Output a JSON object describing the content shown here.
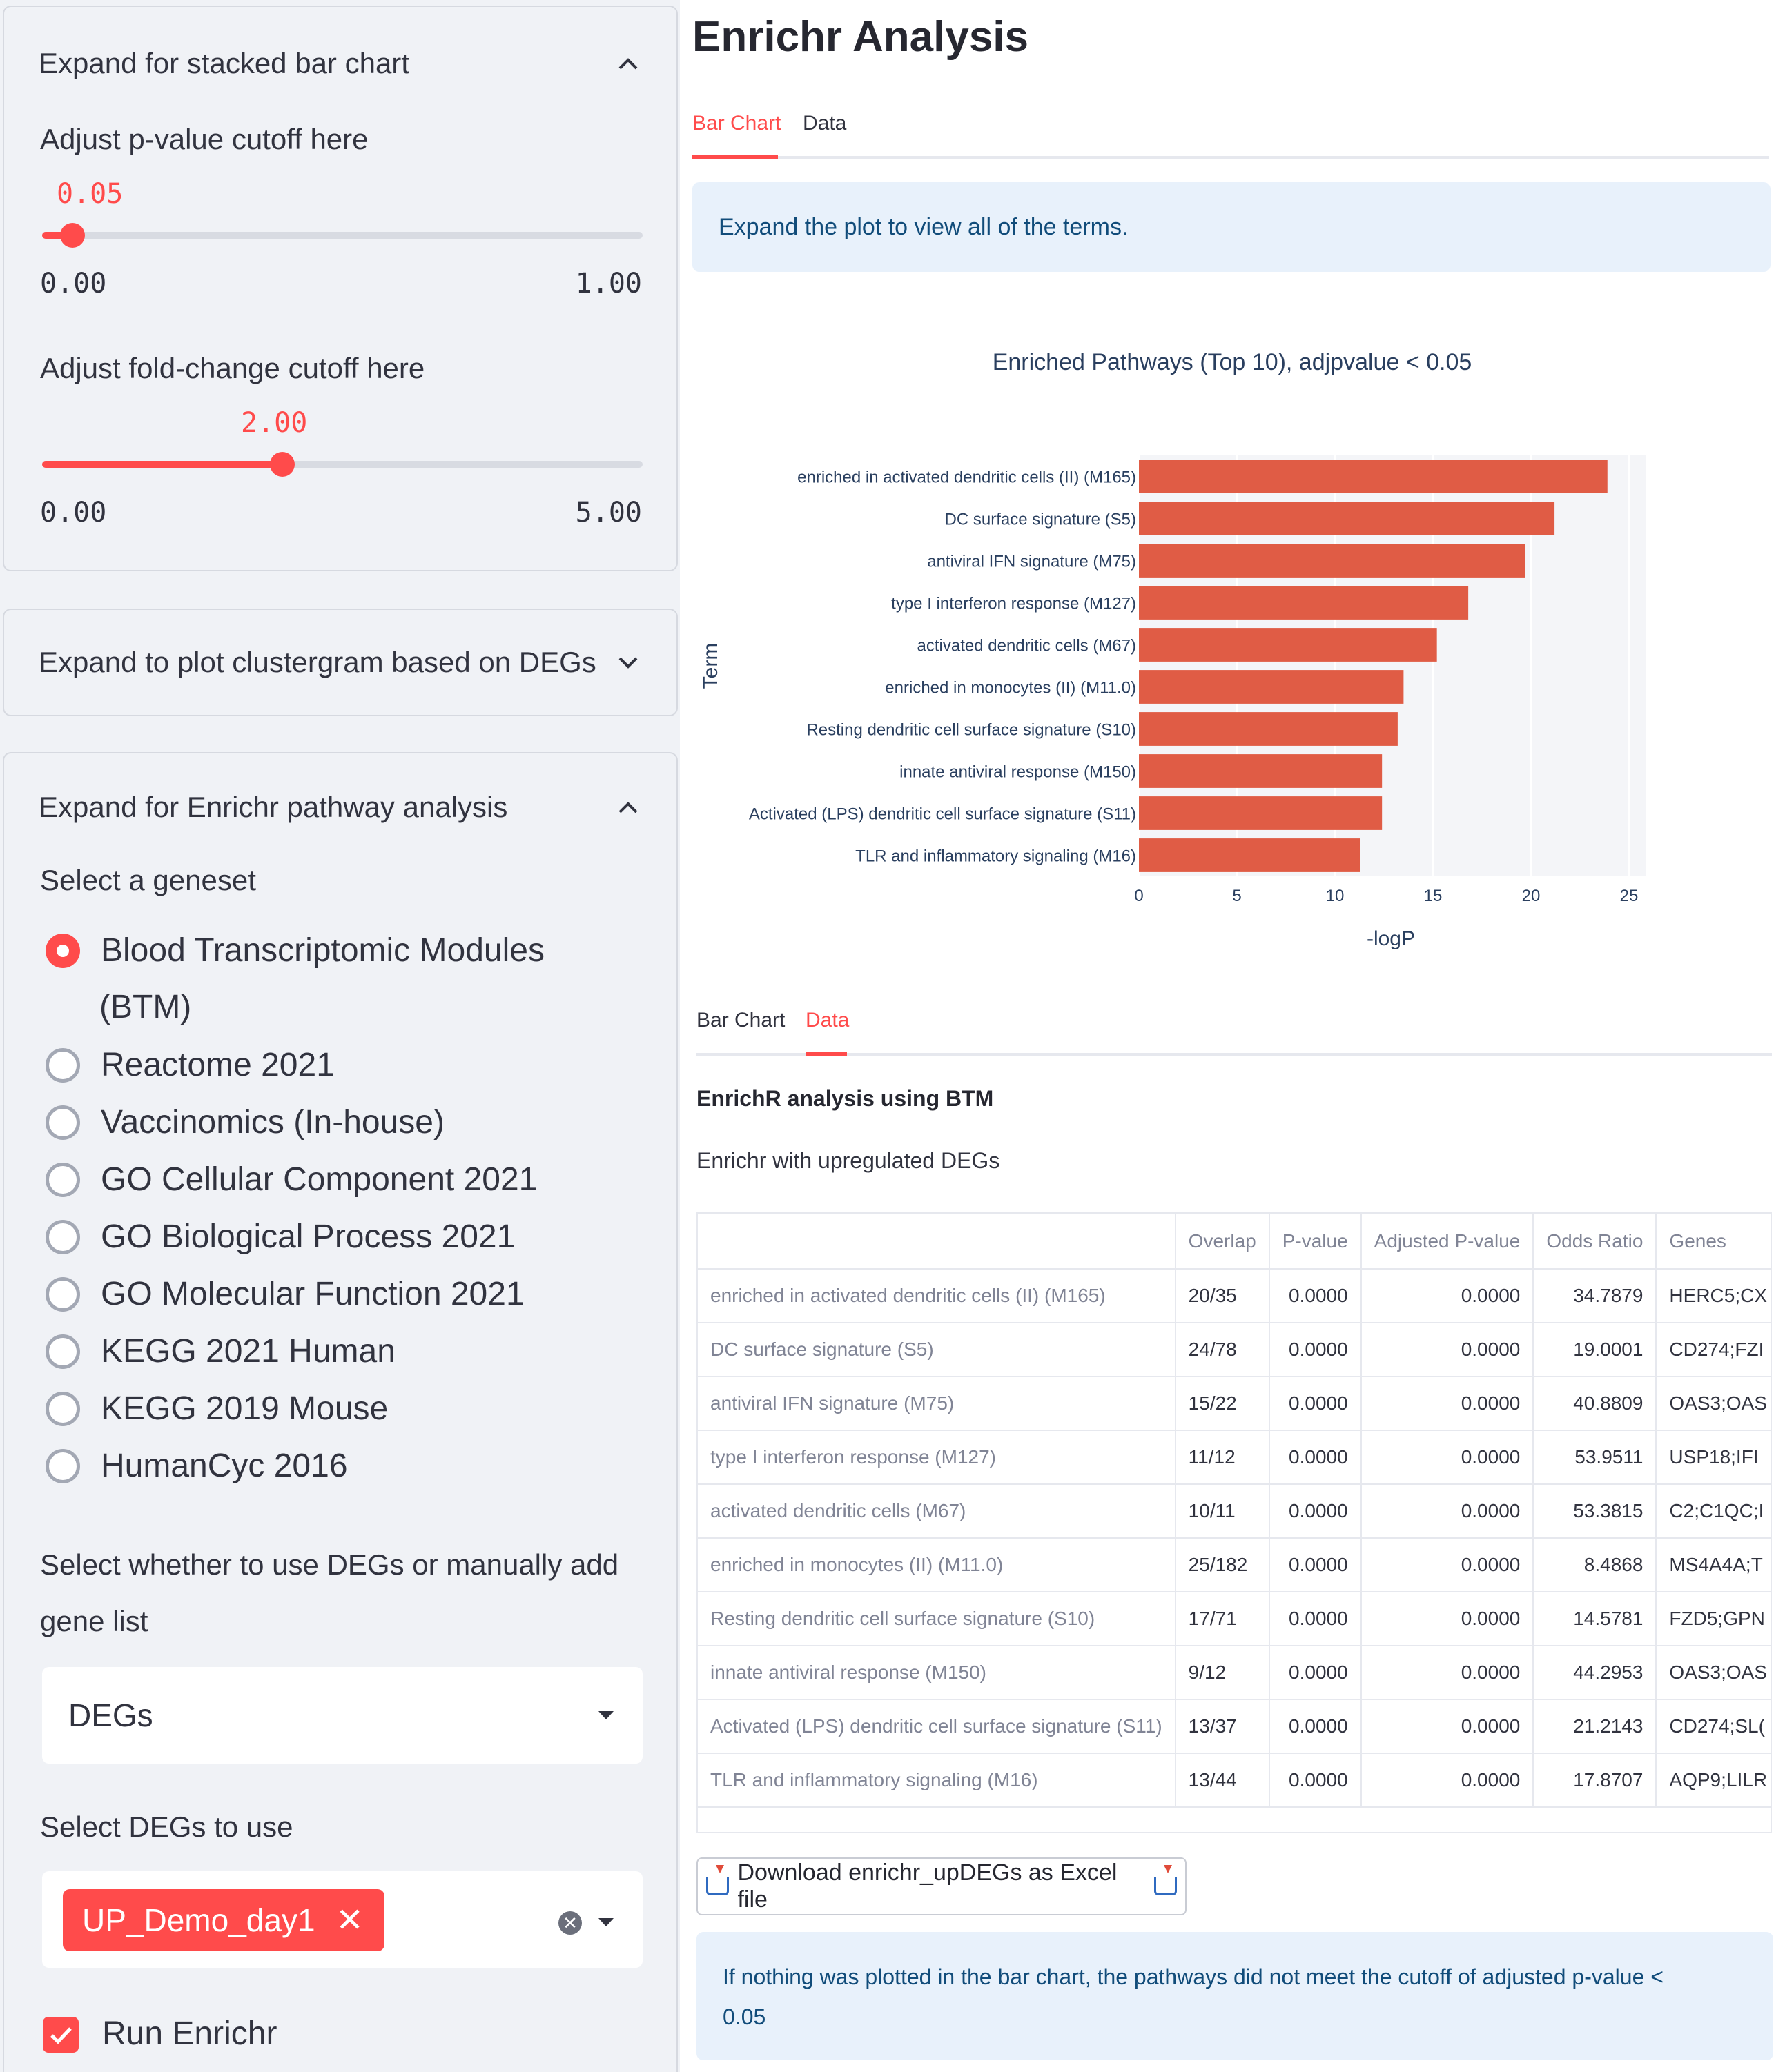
{
  "sidebar": {
    "stacked": {
      "header": "Expand for stacked bar chart",
      "pvalue": {
        "label": "Adjust p-value cutoff here",
        "value": "0.05",
        "value_fraction": 0.05,
        "min": "0.00",
        "max": "1.00"
      },
      "fc": {
        "label": "Adjust fold-change cutoff here",
        "value": "2.00",
        "value_fraction": 0.4,
        "min": "0.00",
        "max": "5.00"
      }
    },
    "clustergram": {
      "header": "Expand to plot clustergram based on DEGs"
    },
    "enrichr": {
      "header": "Expand for Enrichr pathway analysis",
      "geneset_label": "Select a geneset",
      "genesets": [
        {
          "line1": "Blood Transcriptomic Modules",
          "line2": "(BTM)",
          "selected": true
        },
        {
          "line1": "Reactome 2021",
          "selected": false
        },
        {
          "line1": "Vaccinomics (In-house)",
          "selected": false
        },
        {
          "line1": "GO Cellular Component 2021",
          "selected": false
        },
        {
          "line1": "GO Biological Process 2021",
          "selected": false
        },
        {
          "line1": "GO Molecular Function 2021",
          "selected": false
        },
        {
          "line1": "KEGG 2021 Human",
          "selected": false
        },
        {
          "line1": "KEGG 2019 Mouse",
          "selected": false
        },
        {
          "line1": "HumanCyc 2016",
          "selected": false
        }
      ],
      "source_label_1": "Select whether to use DEGs or manually add",
      "source_label_2": "gene list",
      "source_value": "DEGs",
      "degs_label": "Select DEGs to use",
      "degs_tag": "UP_Demo_day1",
      "run_label": "Run Enrichr",
      "run_checked": true
    }
  },
  "main": {
    "title": "Enrichr Analysis",
    "tabs1": [
      "Bar Chart",
      "Data"
    ],
    "info_top": "Expand the plot to view all of the terms.",
    "tabs2": [
      "Bar Chart",
      "Data"
    ],
    "analysis_title": "EnrichR analysis using BTM",
    "subtitle": "Enrichr with upregulated DEGs",
    "table": {
      "columns": [
        "",
        "Overlap",
        "P-value",
        "Adjusted P-value",
        "Odds Ratio",
        "Genes"
      ],
      "rows": [
        [
          "enriched in activated dendritic cells (II) (M165)",
          "20/35",
          "0.0000",
          "0.0000",
          "34.7879",
          "HERC5;CX"
        ],
        [
          "DC surface signature (S5)",
          "24/78",
          "0.0000",
          "0.0000",
          "19.0001",
          "CD274;FZI"
        ],
        [
          "antiviral IFN signature (M75)",
          "15/22",
          "0.0000",
          "0.0000",
          "40.8809",
          "OAS3;OAS"
        ],
        [
          "type I interferon response (M127)",
          "11/12",
          "0.0000",
          "0.0000",
          "53.9511",
          "USP18;IFI"
        ],
        [
          "activated dendritic cells (M67)",
          "10/11",
          "0.0000",
          "0.0000",
          "53.3815",
          "C2;C1QC;I"
        ],
        [
          "enriched in monocytes (II) (M11.0)",
          "25/182",
          "0.0000",
          "0.0000",
          "8.4868",
          "MS4A4A;T"
        ],
        [
          "Resting dendritic cell surface signature (S10)",
          "17/71",
          "0.0000",
          "0.0000",
          "14.5781",
          "FZD5;GPN"
        ],
        [
          "innate antiviral response (M150)",
          "9/12",
          "0.0000",
          "0.0000",
          "44.2953",
          "OAS3;OAS"
        ],
        [
          "Activated (LPS) dendritic cell surface signature (S11)",
          "13/37",
          "0.0000",
          "0.0000",
          "21.2143",
          "CD274;SL("
        ],
        [
          "TLR and inflammatory signaling (M16)",
          "13/44",
          "0.0000",
          "0.0000",
          "17.8707",
          "AQP9;LILR"
        ]
      ]
    },
    "download_label": "Download enrichr_upDEGs as Excel file",
    "info_bottom_1": "If nothing was plotted in the bar chart, the pathways did not meet the cutoff of adjusted p-value <",
    "info_bottom_2": "0.05"
  },
  "chart_data": {
    "type": "bar",
    "orientation": "horizontal",
    "title": "Enriched Pathways (Top 10), adjpvalue < 0.05",
    "xlabel": "-logP",
    "ylabel": "Term",
    "xlim": [
      0,
      25
    ],
    "xticks": [
      "0",
      "5",
      "10",
      "15",
      "20",
      "25"
    ],
    "bar_color": "#e05c45",
    "plot_bg": "#f4f5f8",
    "categories": [
      "enriched in activated dendritic cells (II) (M165)",
      "DC surface signature (S5)",
      "antiviral IFN signature (M75)",
      "type I interferon response (M127)",
      "activated dendritic cells (M67)",
      "enriched in monocytes (II) (M11.0)",
      "Resting dendritic cell surface signature (S10)",
      "innate antiviral response (M150)",
      "Activated (LPS) dendritic cell surface signature (S11)",
      "TLR and inflammatory signaling (M16)"
    ],
    "values": [
      23.9,
      21.2,
      19.7,
      16.8,
      15.2,
      13.5,
      13.2,
      12.4,
      12.4,
      11.3
    ]
  },
  "colors": {
    "accent": "#ff4b4b",
    "info_bg": "#e8f1fb",
    "info_text": "#114c7a"
  }
}
